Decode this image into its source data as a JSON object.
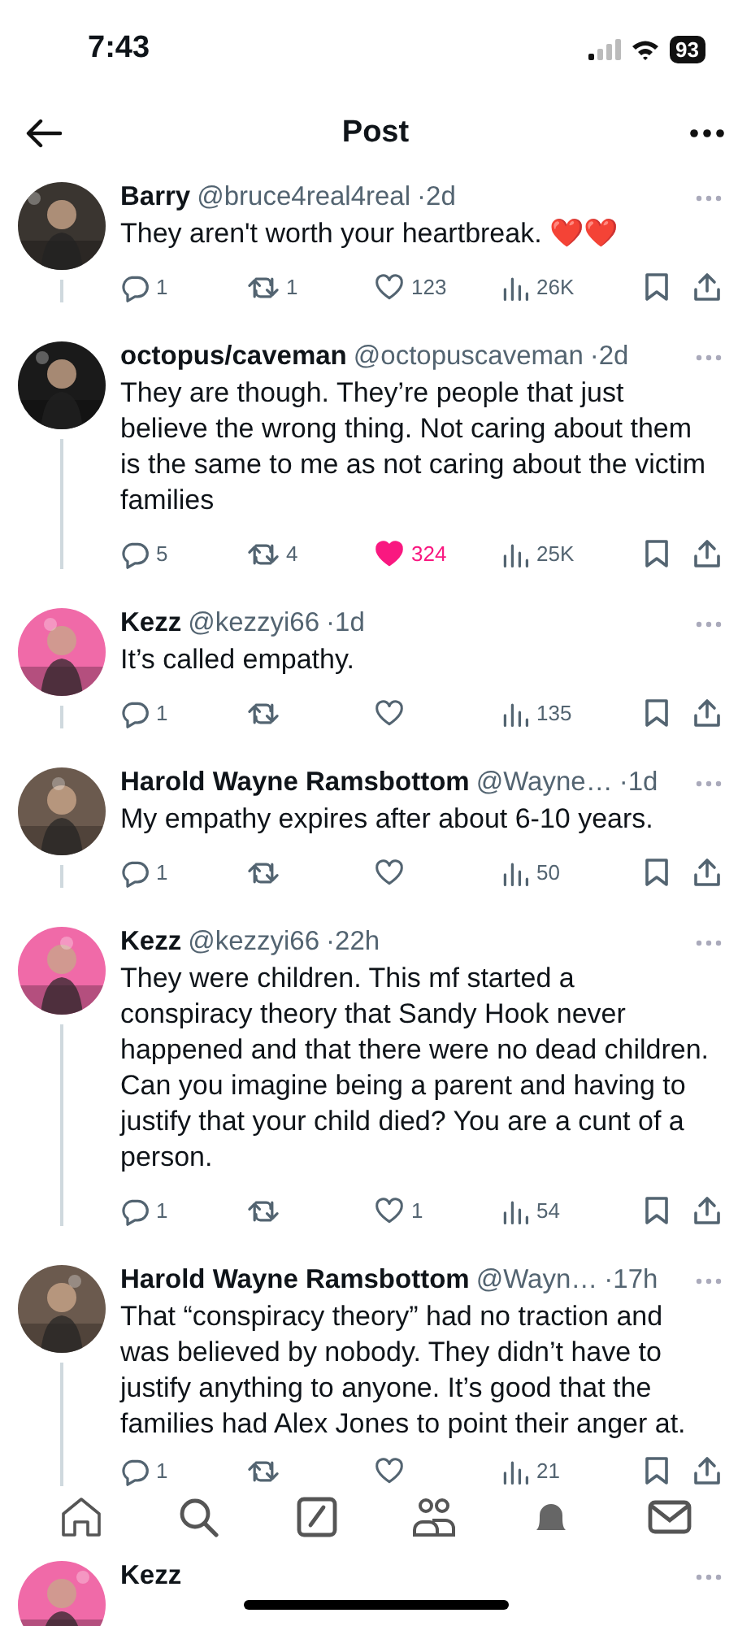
{
  "status_bar": {
    "time": "7:43",
    "battery": "93"
  },
  "header": {
    "title": "Post"
  },
  "replies": [
    {
      "name": "Barry",
      "handle": "@bruce4real4real",
      "time": "·2d",
      "text": "They aren't worth your heartbreak. ❤️❤️",
      "reply": "1",
      "repost": "1",
      "like": "123",
      "liked": false,
      "views": "26K"
    },
    {
      "name": "octopus/caveman",
      "handle": "@octopuscaveman",
      "time": "·2d",
      "text": "They are though. They’re people that just believe the wrong thing. Not caring about them is the same to me as not caring about the victim families",
      "reply": "5",
      "repost": "4",
      "like": "324",
      "liked": true,
      "views": "25K"
    },
    {
      "name": "Kezz",
      "handle": "@kezzyi66",
      "time": "·1d",
      "text": "It’s called empathy.",
      "reply": "1",
      "views": "135",
      "liked": false
    },
    {
      "name": "Harold Wayne Ramsbottom",
      "handle": "@Wayne…",
      "time": "·1d",
      "text": "My empathy expires after about 6-10 years.",
      "reply": "1",
      "views": "50",
      "liked": false
    },
    {
      "name": "Kezz",
      "handle": "@kezzyi66",
      "time": "·22h",
      "text": "They were children. This mf started a conspiracy theory that Sandy Hook never happened and that there were no dead children. Can you imagine being a parent and having to justify that your child died? You are a cunt of a person.",
      "reply": "1",
      "like": "1",
      "liked": false,
      "views": "54"
    },
    {
      "name": "Harold Wayne Ramsbottom",
      "handle": "@Wayn…",
      "time": "·17h",
      "text": "That “conspiracy theory” had no traction and was believed by nobody.  They didn’t have to justify anything to anyone.  It’s good that the families had Alex Jones to point their anger at.",
      "reply": "1",
      "views": "21",
      "liked": false
    },
    {
      "name": "Kezz"
    }
  ]
}
